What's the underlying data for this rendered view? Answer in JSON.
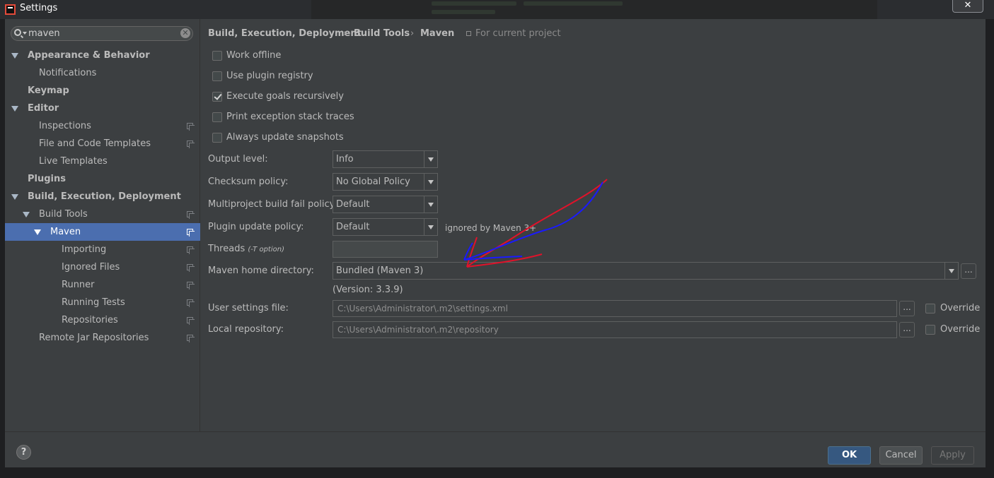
{
  "window": {
    "title": "Settings",
    "close_glyph": "✕"
  },
  "sidebar": {
    "search": {
      "value": "maven",
      "placeholder": ""
    },
    "tree": [
      {
        "label": "Appearance & Behavior",
        "level": 0,
        "expanded": true,
        "bold": true
      },
      {
        "label": "Notifications",
        "level": 1
      },
      {
        "label": "Keymap",
        "level": 0,
        "bold": true
      },
      {
        "label": "Editor",
        "level": 0,
        "expanded": true,
        "bold": true
      },
      {
        "label": "Inspections",
        "level": 1,
        "project_icon": true
      },
      {
        "label": "File and Code Templates",
        "level": 1,
        "project_icon": true
      },
      {
        "label": "Live Templates",
        "level": 1
      },
      {
        "label": "Plugins",
        "level": 0,
        "bold": true
      },
      {
        "label": "Build, Execution, Deployment",
        "level": 0,
        "expanded": true,
        "bold": true
      },
      {
        "label": "Build Tools",
        "level": 1,
        "expanded": true,
        "project_icon": true
      },
      {
        "label": "Maven",
        "level": 2,
        "expanded": true,
        "selected": true,
        "project_icon": true
      },
      {
        "label": "Importing",
        "level": 3,
        "project_icon": true
      },
      {
        "label": "Ignored Files",
        "level": 3,
        "project_icon": true
      },
      {
        "label": "Runner",
        "level": 3,
        "project_icon": true
      },
      {
        "label": "Running Tests",
        "level": 3,
        "project_icon": true
      },
      {
        "label": "Repositories",
        "level": 3,
        "project_icon": true
      },
      {
        "label": "Remote Jar Repositories",
        "level": 1,
        "project_icon": true
      }
    ]
  },
  "breadcrumb": {
    "items": [
      "Build, Execution, Deployment",
      "Build Tools",
      "Maven"
    ],
    "separator": "›",
    "scope": "For current project"
  },
  "checkboxes": [
    {
      "label": "Work offline",
      "checked": false
    },
    {
      "label": "Use plugin registry",
      "checked": false
    },
    {
      "label": "Execute goals recursively",
      "checked": true
    },
    {
      "label": "Print exception stack traces",
      "checked": false
    },
    {
      "label": "Always update snapshots",
      "checked": false
    }
  ],
  "form": {
    "output_level": {
      "label": "Output level:",
      "value": "Info"
    },
    "checksum_policy": {
      "label": "Checksum policy:",
      "value": "No Global Policy"
    },
    "fail_policy": {
      "label": "Multiproject build fail policy:",
      "value": "Default"
    },
    "plugin_update_policy": {
      "label": "Plugin update policy:",
      "value": "Default",
      "hint": "ignored by Maven 3+"
    },
    "threads": {
      "label": "Threads",
      "note": "(-T option)",
      "value": ""
    },
    "maven_home": {
      "label": "Maven home directory:",
      "value": "Bundled (Maven 3)",
      "version": "(Version: 3.3.9)"
    },
    "user_settings": {
      "label": "User settings file:",
      "value": "C:\\Users\\Administrator\\.m2\\settings.xml",
      "override_label": "Override",
      "override": false
    },
    "local_repo": {
      "label": "Local repository:",
      "value": "C:\\Users\\Administrator\\.m2\\repository",
      "override_label": "Override",
      "override": false
    },
    "browse_label": "..."
  },
  "buttons": {
    "help": "?",
    "ok": "OK",
    "cancel": "Cancel",
    "apply": "Apply"
  },
  "colors": {
    "background": "#3c3f41",
    "selection": "#4b6eaf",
    "annotation_red": "#e0122a",
    "annotation_blue": "#1a1aff"
  }
}
